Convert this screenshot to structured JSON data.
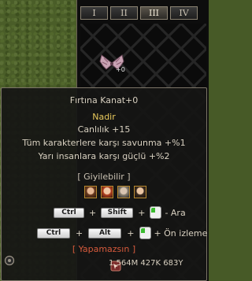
{
  "inventory": {
    "tabs": [
      "I",
      "II",
      "III",
      "IV"
    ],
    "active_tab": "III",
    "item_count": "+0"
  },
  "tooltip": {
    "name": "Fırtına Kanat+0",
    "rarity": "Nadir",
    "stats": [
      "Canlılık +15",
      "Tüm karakterlere karşı savunma +%1",
      "Yarı insanlara karşı güçlü +%2"
    ],
    "wearable_label": "[ Giyilebilir ]",
    "hotkeys": {
      "row1": {
        "k1": "Ctrl",
        "plus1": "+",
        "k2": "Shift",
        "plus2": "+",
        "action": "- Ara"
      },
      "row2": {
        "k1": "Ctrl",
        "plus1": "+",
        "k2": "Alt",
        "plus2": "+",
        "action": "+ Ön izleme"
      }
    },
    "cannot_label": "[ Yapamazsın ]",
    "money": "1    564M 427K 683Y"
  },
  "colors": {
    "rarity": "#e8c95c",
    "cannot": "#d65a3c",
    "border": "#7d7668"
  }
}
